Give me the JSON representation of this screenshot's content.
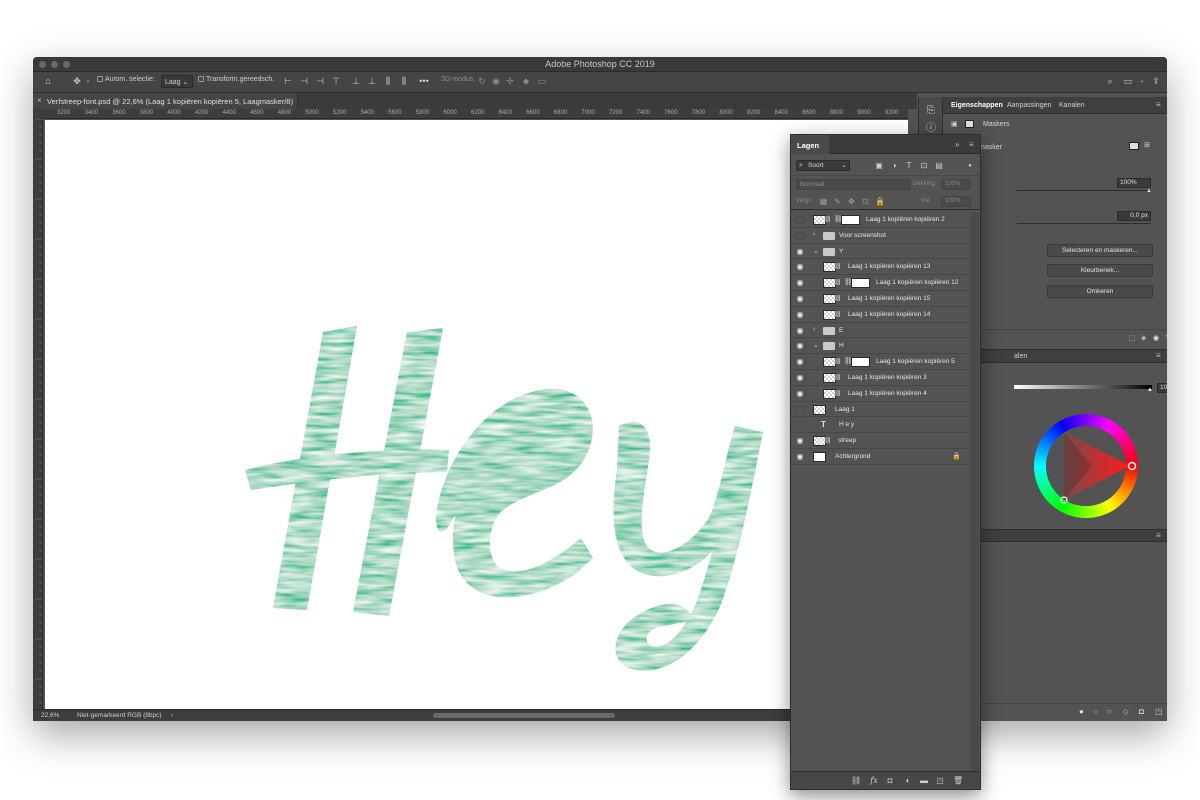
{
  "window": {
    "title": "Adobe Photoshop CC 2019"
  },
  "options_bar": {
    "auto_select_label": "Autom. selectie:",
    "auto_select_target": "Laag",
    "transform_label": "Transform.gereedsch.",
    "mode_3d_label": "3D-modus:"
  },
  "document": {
    "tab_title": "Verfstreep-font.psd @ 22,6% (Laag 1 kopiëren kopiëren 5, Laagmasker/8)",
    "ruler_ticks": [
      "3200",
      "3400",
      "3600",
      "3800",
      "4000",
      "4200",
      "4400",
      "4600",
      "4800",
      "5000",
      "5200",
      "5400",
      "5600",
      "5800",
      "6000",
      "6200",
      "6400",
      "6600",
      "6800",
      "7000",
      "7200",
      "7400",
      "7600",
      "7800",
      "8000",
      "8200",
      "8400",
      "8600",
      "8800",
      "9000",
      "9200"
    ],
    "canvas_text": "Hey",
    "canvas_color": "#3dbf8e"
  },
  "status_bar": {
    "zoom": "22,6%",
    "color_profile": "Niet-gemarkeerd RGB (8bpc)"
  },
  "properties_panel": {
    "tabs": [
      "Eigenschappen",
      "Aanpassingen",
      "Kanalen"
    ],
    "section_label": "Maskers",
    "mask_label": "masker",
    "density_value": "100%",
    "feather_value": "0,0 px",
    "buttons": [
      "Selecteren en maskeren...",
      "Kleurbereik...",
      "Omkeren"
    ]
  },
  "color_panel": {
    "tab_label": "alen",
    "opacity_value": "100",
    "opacity_unit": "%"
  },
  "layers_panel": {
    "title": "Lagen",
    "filter_label": "Soort",
    "blend_mode": "Normaal",
    "opacity_label": "Dekking:",
    "opacity_value": "100%",
    "lock_label": "Vergr.:",
    "fill_label": "Vul:",
    "fill_value": "100%",
    "layers": [
      {
        "name": "Laag 1 kopiëren kopiëren 2",
        "visible": false,
        "indent": 0,
        "kind": "masked"
      },
      {
        "name": "Voor screenshot",
        "visible": false,
        "indent": 0,
        "kind": "group-closed"
      },
      {
        "name": "Y",
        "visible": true,
        "indent": 0,
        "kind": "group-open"
      },
      {
        "name": "Laag 1 kopiëren kopiëren 13",
        "visible": true,
        "indent": 1,
        "kind": "smart"
      },
      {
        "name": "Laag 1 kopiëren kopiëren 12",
        "visible": true,
        "indent": 1,
        "kind": "masked"
      },
      {
        "name": "Laag 1 kopiëren kopiëren 15",
        "visible": true,
        "indent": 1,
        "kind": "smart"
      },
      {
        "name": "Laag 1 kopiëren kopiëren 14",
        "visible": true,
        "indent": 1,
        "kind": "smart"
      },
      {
        "name": "E",
        "visible": true,
        "indent": 0,
        "kind": "group-closed"
      },
      {
        "name": "H",
        "visible": true,
        "indent": 0,
        "kind": "group-open"
      },
      {
        "name": "Laag 1 kopiëren kopiëren 5",
        "visible": true,
        "indent": 1,
        "kind": "masked"
      },
      {
        "name": "Laag 1 kopiëren kopiëren 3",
        "visible": true,
        "indent": 1,
        "kind": "smart"
      },
      {
        "name": "Laag 1 kopiëren kopiëren 4",
        "visible": true,
        "indent": 1,
        "kind": "smart"
      },
      {
        "name": "Laag 1",
        "visible": false,
        "indent": 0,
        "kind": "pixel"
      },
      {
        "name": "H e y",
        "visible": false,
        "indent": 0,
        "kind": "text"
      },
      {
        "name": "streep",
        "visible": true,
        "indent": 0,
        "kind": "smart"
      },
      {
        "name": "Achtergrond",
        "visible": true,
        "indent": 0,
        "kind": "background"
      }
    ]
  }
}
